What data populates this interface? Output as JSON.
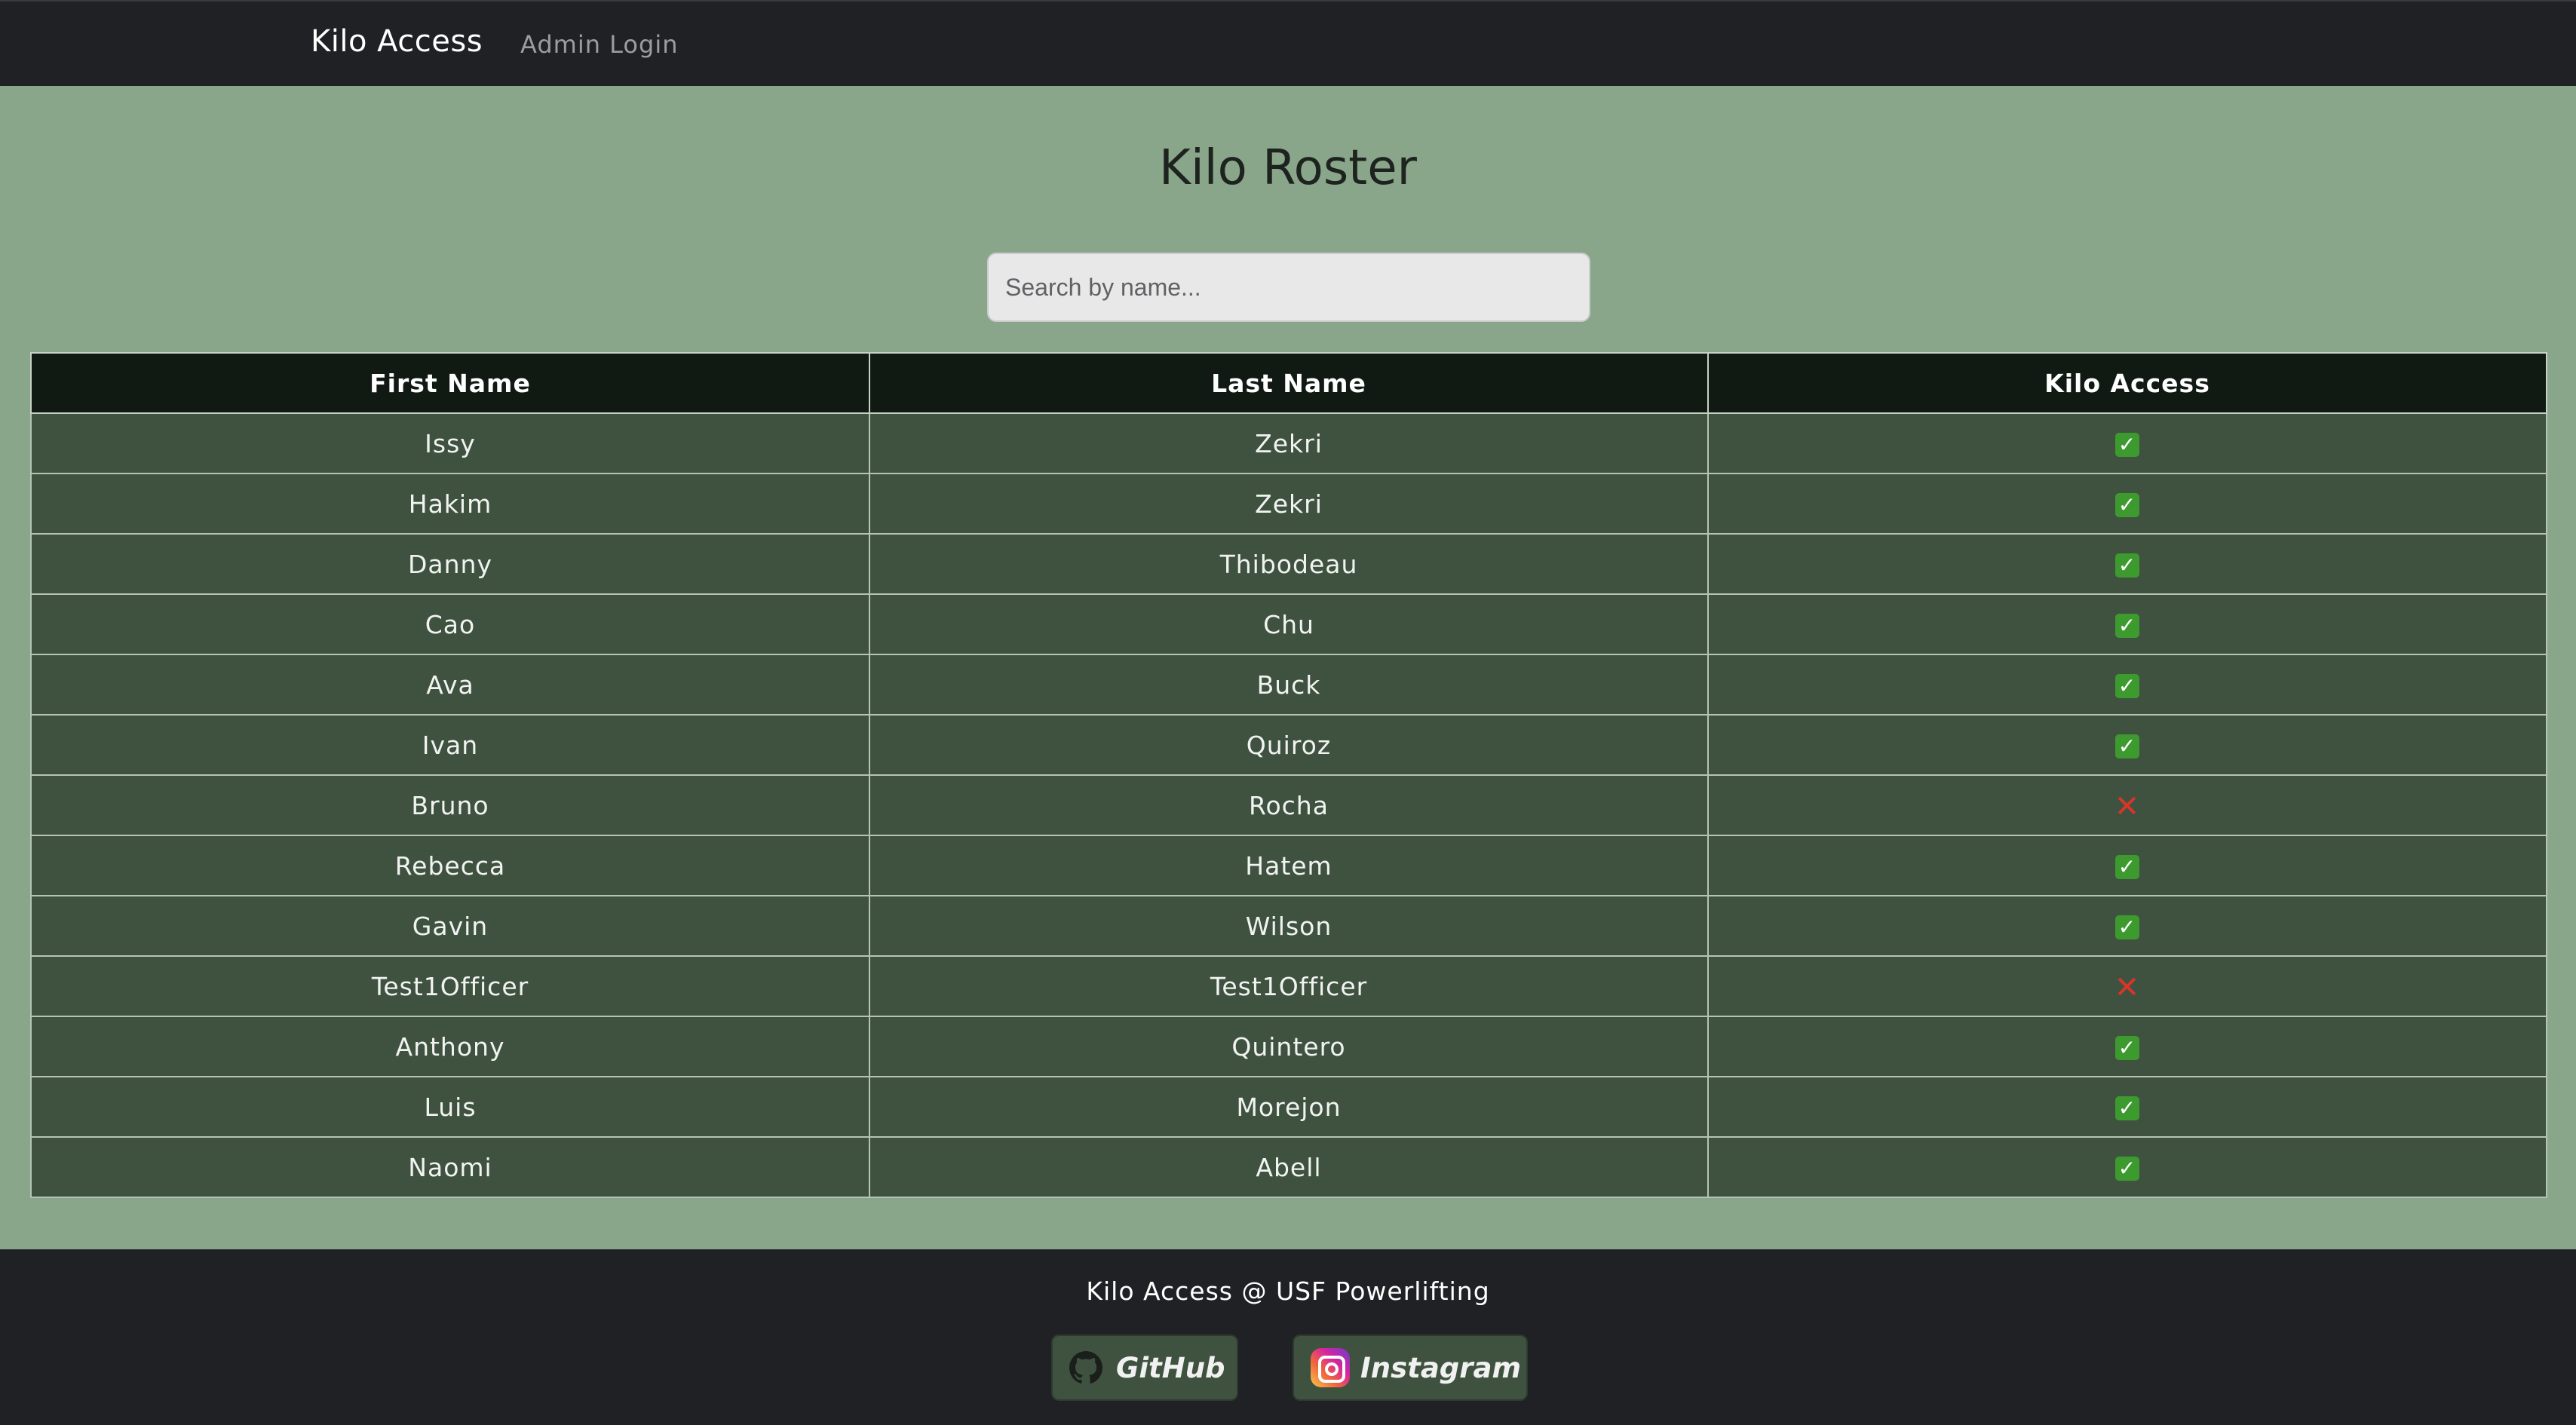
{
  "navbar": {
    "brand": "Kilo Access",
    "links": [
      "Admin Login"
    ]
  },
  "main": {
    "title": "Kilo Roster",
    "search_placeholder": "Search by name...",
    "table": {
      "headers": [
        "First Name",
        "Last Name",
        "Kilo Access"
      ],
      "rows": [
        {
          "first": "Issy",
          "last": "Zekri",
          "access": true
        },
        {
          "first": "Hakim",
          "last": "Zekri",
          "access": true
        },
        {
          "first": "Danny",
          "last": "Thibodeau",
          "access": true
        },
        {
          "first": "Cao",
          "last": "Chu",
          "access": true
        },
        {
          "first": "Ava",
          "last": "Buck",
          "access": true
        },
        {
          "first": "Ivan",
          "last": "Quiroz",
          "access": true
        },
        {
          "first": "Bruno",
          "last": "Rocha",
          "access": false
        },
        {
          "first": "Rebecca",
          "last": "Hatem",
          "access": true
        },
        {
          "first": "Gavin",
          "last": "Wilson",
          "access": true
        },
        {
          "first": "Test1Officer",
          "last": "Test1Officer",
          "access": false
        },
        {
          "first": "Anthony",
          "last": "Quintero",
          "access": true
        },
        {
          "first": "Luis",
          "last": "Morejon",
          "access": true
        },
        {
          "first": "Naomi",
          "last": "Abell",
          "access": true
        }
      ]
    }
  },
  "footer": {
    "text": "Kilo Access @ USF Powerlifting",
    "github_label": "GitHub",
    "instagram_label": "Instagram"
  },
  "icons": {
    "access_granted": "check-mark-icon",
    "access_denied": "cross-mark-icon",
    "github": "github-icon",
    "instagram": "instagram-icon"
  },
  "colors": {
    "page_background": "#8aa68a",
    "navbar_background": "#202124",
    "table_header_background": "#101a13",
    "table_row_background": "#3f5240",
    "check_green": "#3d9a2e",
    "cross_red": "#d9352a"
  }
}
